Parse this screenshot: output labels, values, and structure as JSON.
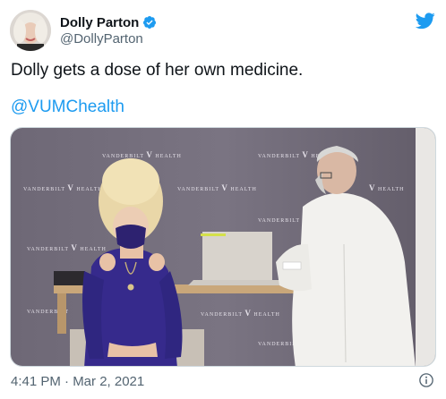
{
  "author": {
    "display_name": "Dolly Parton",
    "handle": "@DollyParton",
    "verified_icon": "verified-badge-icon",
    "avatar_icon": "profile-photo"
  },
  "tweet": {
    "text": "Dolly gets a dose of her own medicine.",
    "mention": "@VUMChealth"
  },
  "media": {
    "backdrop_wordmark": "VANDERBILT",
    "backdrop_suffix": "HEALTH",
    "backdrop_letter": "V"
  },
  "meta": {
    "timestamp": "4:41 PM · Mar 2, 2021"
  },
  "colors": {
    "link": "#1d9bf0",
    "twitter_brand": "#1d9bf0",
    "secondary_text": "#536471"
  }
}
